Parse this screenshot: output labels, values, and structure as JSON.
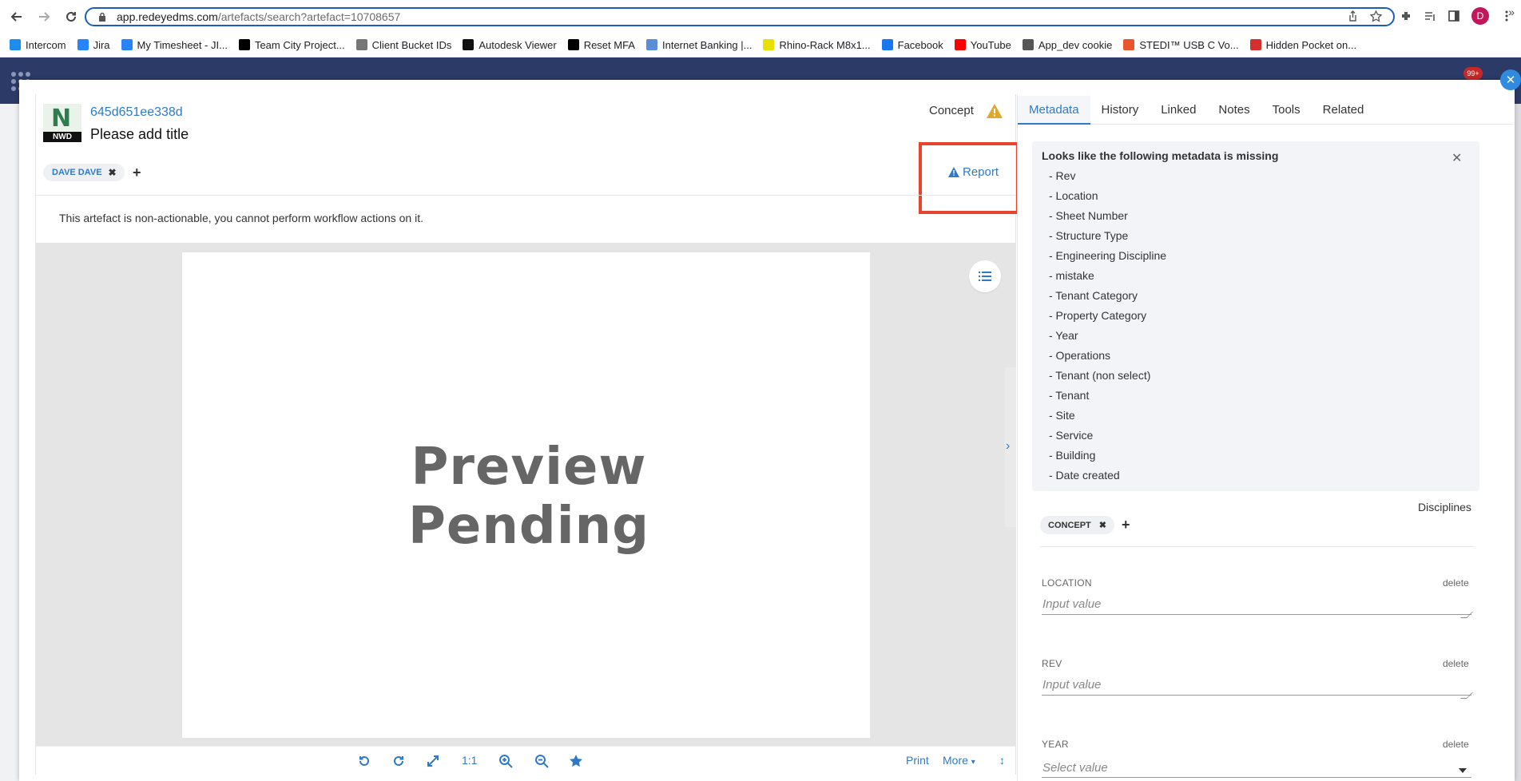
{
  "browser": {
    "url_host": "app.redeyedms.com",
    "url_path": "/artefacts/search?artefact=10708657",
    "profile_initial": "D",
    "bookmarks": [
      {
        "label": "Intercom",
        "color": "#1f8ded"
      },
      {
        "label": "Jira",
        "color": "#2684ff"
      },
      {
        "label": "My Timesheet - JI...",
        "color": "#2684ff"
      },
      {
        "label": "Team City Project...",
        "color": "#000000"
      },
      {
        "label": "Client Bucket IDs",
        "color": "#777777"
      },
      {
        "label": "Autodesk Viewer",
        "color": "#111111"
      },
      {
        "label": "Reset MFA",
        "color": "#000000"
      },
      {
        "label": "Internet Banking |...",
        "color": "#5a8fd8"
      },
      {
        "label": "Rhino-Rack M8x1...",
        "color": "#e8e000"
      },
      {
        "label": "Facebook",
        "color": "#1877f2"
      },
      {
        "label": "YouTube",
        "color": "#ff0000"
      },
      {
        "label": "App_dev cookie",
        "color": "#555555"
      },
      {
        "label": "STEDI™ USB C Vo...",
        "color": "#e8552d"
      },
      {
        "label": "Hidden Pocket on...",
        "color": "#d32f2f"
      }
    ]
  },
  "app": {
    "notification_badge": "99+"
  },
  "artefact": {
    "id": "645d651ee338d",
    "title": "Please add title",
    "file_type": "NWD",
    "file_letter": "N",
    "status": "Concept",
    "tag": "DAVE DAVE",
    "report_label": "Report",
    "notice": "This artefact is non-actionable, you cannot perform workflow actions on it.",
    "preview_line1": "Preview",
    "preview_line2": "Pending"
  },
  "toolbar": {
    "zoom_ratio": "1:1",
    "print_label": "Print",
    "more_label": "More"
  },
  "tabs": [
    "Metadata",
    "History",
    "Linked",
    "Notes",
    "Tools",
    "Related"
  ],
  "metadata": {
    "missing_title": "Looks like the following metadata is missing",
    "missing_items": [
      "- Rev",
      "- Location",
      "- Sheet Number",
      "- Structure Type",
      "- Engineering Discipline",
      "- mistake",
      "- Tenant Category",
      "- Property Category",
      "- Year",
      "- Operations",
      "- Tenant (non select)",
      "- Tenant",
      "- Site",
      "- Service",
      "- Building",
      "- Date created"
    ],
    "disciplines_label": "Disciplines",
    "discipline_chip": "CONCEPT",
    "fields": [
      {
        "label": "LOCATION",
        "delete": "delete",
        "placeholder": "Input value"
      },
      {
        "label": "REV",
        "delete": "delete",
        "placeholder": "Input value"
      },
      {
        "label": "YEAR",
        "delete": "delete",
        "placeholder": "Select value"
      }
    ]
  },
  "colors": {
    "accent": "#2f7ac8",
    "highlight_box": "#e5452f",
    "warning": "#e0a72d",
    "app_header": "#2b3a67"
  }
}
